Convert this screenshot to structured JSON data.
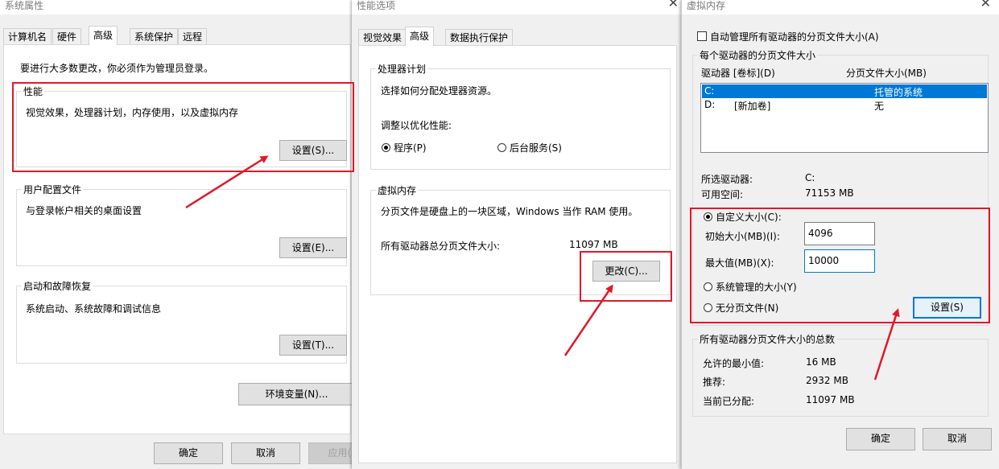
{
  "w1": {
    "title": "系统属性",
    "tabs": [
      "计算机名",
      "硬件",
      "高级",
      "系统保护",
      "远程"
    ],
    "admin_note": "要进行大多数更改，你必须作为管理员登录。",
    "perf": {
      "title": "性能",
      "desc": "视觉效果，处理器计划，内存使用，以及虚拟内存",
      "button": "设置(S)..."
    },
    "profile": {
      "title": "用户配置文件",
      "desc": "与登录帐户相关的桌面设置",
      "button": "设置(E)..."
    },
    "startup": {
      "title": "启动和故障恢复",
      "desc": "系统启动、系统故障和调试信息",
      "button": "设置(T)..."
    },
    "env_button": "环境变量(N)...",
    "ok": "确定",
    "cancel": "取消",
    "apply": "应用(A"
  },
  "w2": {
    "title": "性能选项",
    "tabs": [
      "视觉效果",
      "高级",
      "数据执行保护"
    ],
    "cpu": {
      "title": "处理器计划",
      "desc": "选择如何分配处理器资源。",
      "adjust": "调整以优化性能:",
      "opt_programs": "程序(P)",
      "opt_services": "后台服务(S)"
    },
    "vm": {
      "title": "虚拟内存",
      "desc": "分页文件是硬盘上的一块区域，Windows 当作 RAM 使用。",
      "total_label": "所有驱动器总分页文件大小:",
      "total_value": "11097 MB",
      "button": "更改(C)..."
    }
  },
  "w3": {
    "title": "虚拟内存",
    "auto_manage": "自动管理所有驱动器的分页文件大小(A)",
    "per_drive": {
      "title": "每个驱动器的分页文件大小",
      "col_drive": "驱动器 [卷标](D)",
      "col_size": "分页文件大小(MB)",
      "rows": [
        {
          "drive": "C:",
          "label": "",
          "size": "托管的系统"
        },
        {
          "drive": "D:",
          "label": "[新加卷]",
          "size": "无"
        }
      ],
      "selected_label": "所选驱动器:",
      "selected_value": "C:",
      "free_label": "可用空间:",
      "free_value": "71153 MB",
      "custom": "自定义大小(C):",
      "initial_label": "初始大小(MB)(I):",
      "initial_value": "4096",
      "max_label": "最大值(MB)(X):",
      "max_value": "10000",
      "system_managed": "系统管理的大小(Y)",
      "no_paging": "无分页文件(N)",
      "set_button": "设置(S)"
    },
    "totals": {
      "title": "所有驱动器分页文件大小的总数",
      "min_label": "允许的最小值:",
      "min_value": "16 MB",
      "rec_label": "推荐:",
      "rec_value": "2932 MB",
      "cur_label": "当前已分配:",
      "cur_value": "11097 MB"
    },
    "ok": "确定",
    "cancel": "取消"
  },
  "annotation_color": "#e0192a"
}
